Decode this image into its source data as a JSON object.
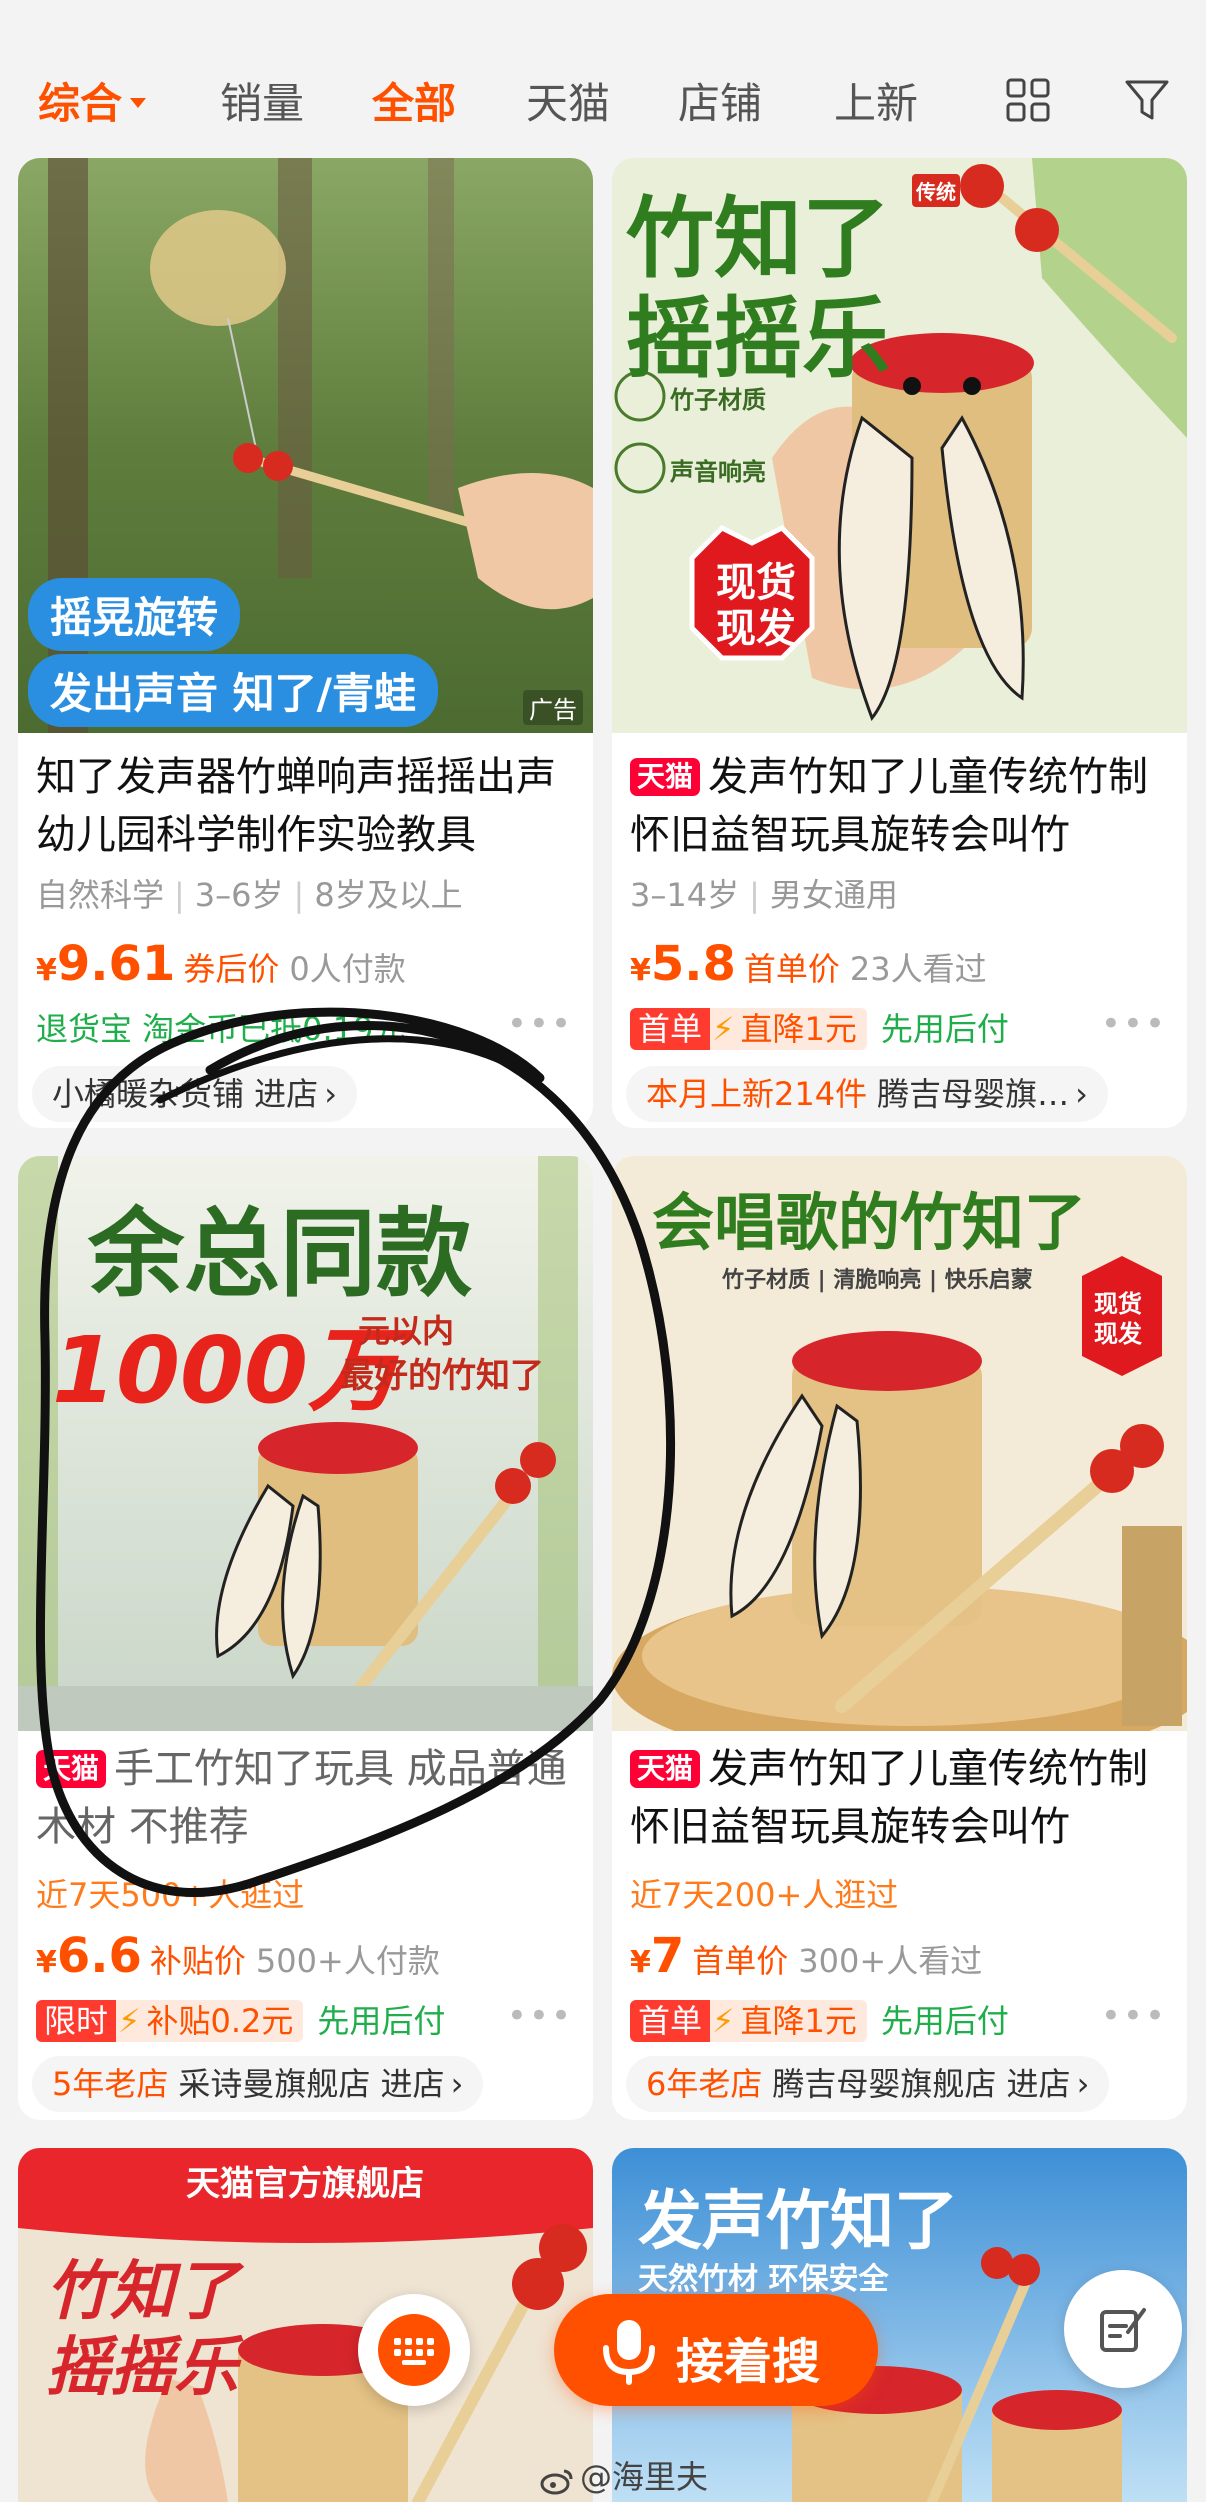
{
  "sort": {
    "tabs": [
      "综合",
      "销量",
      "全部",
      "天猫",
      "店铺",
      "上新"
    ]
  },
  "cards": [
    {
      "title": "知了发声器竹蝉响声摇摇出声幼儿园科学制作实验教具",
      "attrs": [
        "自然科学",
        "3–6岁",
        "8岁及以上"
      ],
      "yen": "¥",
      "price": "9.61",
      "price_type": "券后价",
      "sold": "0人付款",
      "promo_text": "退货宝  淘金币已抵0.19元",
      "shop": "小橘暖杂货铺 进店",
      "ad": "广告",
      "img_text": [
        "摇晃旋转",
        "发出声音 知了/青蛙"
      ]
    },
    {
      "badge": "天猫",
      "title": "发声竹知了儿童传统竹制怀旧益智玩具旋转会叫竹",
      "attrs": [
        "3–14岁",
        "男女通用"
      ],
      "yen": "¥",
      "price": "5.8",
      "price_type": "首单价",
      "sold": "23人看过",
      "promo_tag": "首单",
      "promo_deal": "直降1元",
      "promo_extra": "先用后付",
      "shop_prefix": "本月上新214件",
      "shop": "腾吉母婴旗…",
      "img_text": [
        "竹知了",
        "摇摇乐",
        "传统",
        "竹子材质",
        "声音响亮",
        "现货",
        "现发"
      ]
    },
    {
      "badge": "天猫",
      "title": "手工竹知了玩具 成品普通木材 不推荐",
      "visits": "近7天500+人逛过",
      "yen": "¥",
      "price": "6.6",
      "price_type": "补贴价",
      "sold": "500+人付款",
      "promo_tag": "限时",
      "promo_deal": "补贴0.2元",
      "promo_extra": "先用后付",
      "shop_prefix": "5年老店",
      "shop": "采诗曼旗舰店 进店",
      "img_text": [
        "余总同款",
        "1000万",
        "元以内",
        "最好的竹知了"
      ]
    },
    {
      "badge": "天猫",
      "title": "发声竹知了儿童传统竹制怀旧益智玩具旋转会叫竹",
      "visits": "近7天200+人逛过",
      "yen": "¥",
      "price": "7",
      "price_type": "首单价",
      "sold": "300+人看过",
      "promo_tag": "首单",
      "promo_deal": "直降1元",
      "promo_extra": "先用后付",
      "shop_prefix": "6年老店",
      "shop": "腾吉母婴旗舰店 进店",
      "img_text": [
        "会唱歌的竹知了",
        "竹子材质 | 清脆响亮 | 快乐启蒙",
        "现货",
        "现发"
      ]
    },
    {
      "img_text": [
        "天猫官方旗舰店",
        "竹知了",
        "摇摇乐"
      ]
    },
    {
      "img_text": [
        "发声竹知了",
        "天然竹材 环保安全"
      ]
    }
  ],
  "floating": {
    "voice_label": "接着搜"
  },
  "watermark": "@海里夫",
  "colors": {
    "accent": "#ff5000",
    "tmall": "#ff0036",
    "green": "#1fae4b",
    "annotation": "#111111"
  },
  "icons": [
    "caret-down-icon",
    "grid-view-icon",
    "filter-icon",
    "bolt-icon",
    "chevron-right-icon",
    "keyboard-icon",
    "microphone-icon",
    "edit-icon",
    "weibo-icon"
  ]
}
